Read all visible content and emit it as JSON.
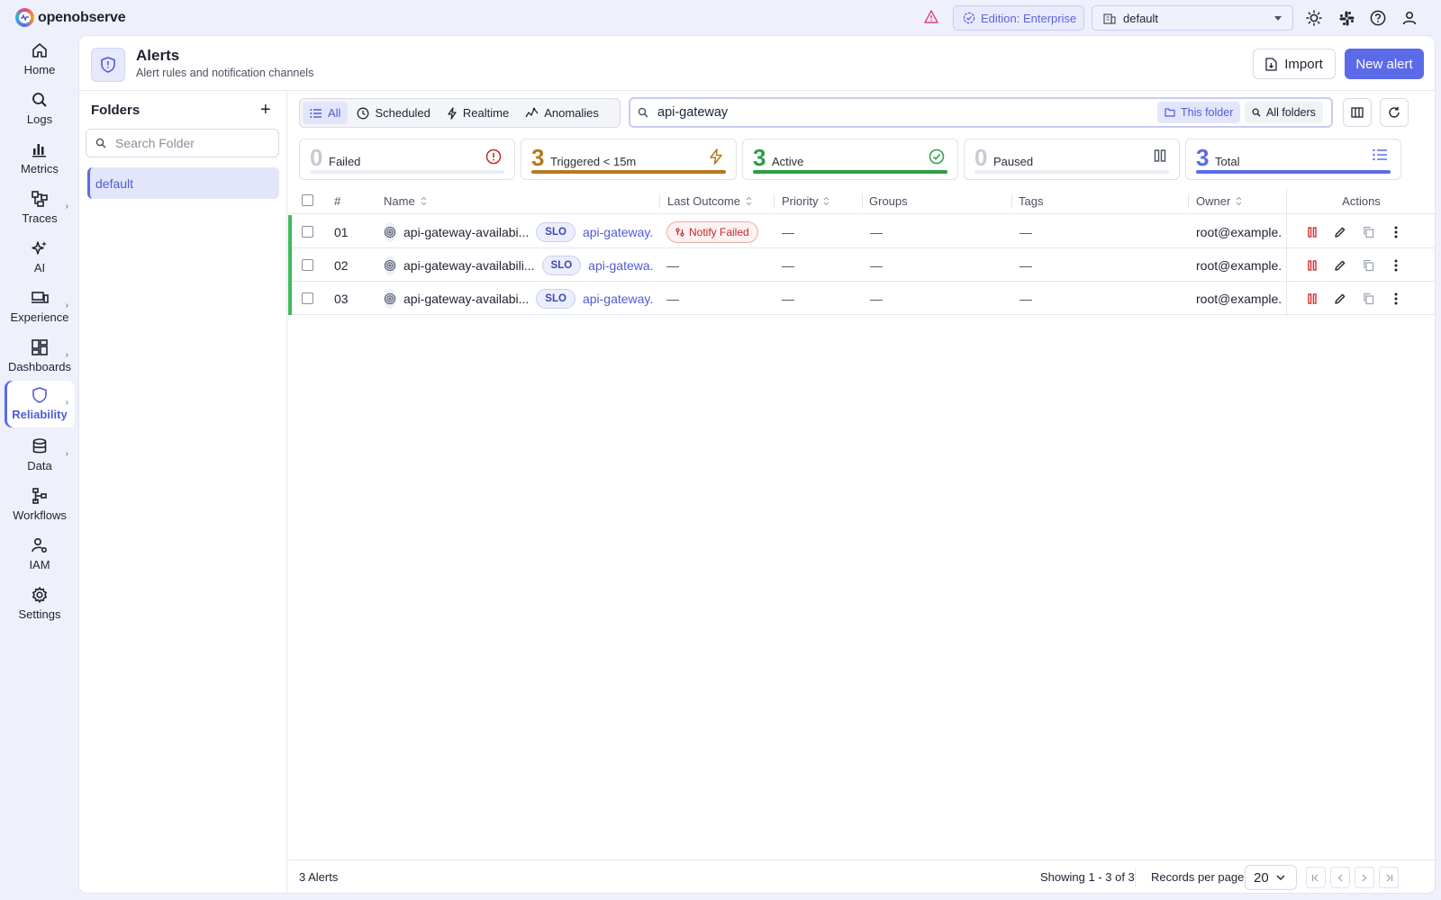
{
  "app": {
    "name": "openobserve"
  },
  "topbar": {
    "edition": "Edition: Enterprise",
    "org": "default"
  },
  "nav": [
    {
      "label": "Home",
      "icon": "home-icon"
    },
    {
      "label": "Logs",
      "icon": "search-icon"
    },
    {
      "label": "Metrics",
      "icon": "bar-chart-icon"
    },
    {
      "label": "Traces",
      "icon": "traces-icon"
    },
    {
      "label": "AI",
      "icon": "sparkle-icon"
    },
    {
      "label": "Experience",
      "icon": "devices-icon"
    },
    {
      "label": "Dashboards",
      "icon": "dashboard-icon"
    },
    {
      "label": "Reliability",
      "icon": "shield-icon"
    },
    {
      "label": "Data",
      "icon": "database-icon"
    },
    {
      "label": "Workflows",
      "icon": "workflow-icon"
    },
    {
      "label": "IAM",
      "icon": "user-gear-icon"
    },
    {
      "label": "Settings",
      "icon": "gear-icon"
    }
  ],
  "header": {
    "title": "Alerts",
    "subtitle": "Alert rules and notification channels",
    "import_label": "Import",
    "new_label": "New alert"
  },
  "folders": {
    "title": "Folders",
    "search_placeholder": "Search Folder",
    "items": [
      "default"
    ]
  },
  "filters": {
    "tabs": [
      "All",
      "Scheduled",
      "Realtime",
      "Anomalies"
    ],
    "active": "All",
    "search_value": "api-gateway",
    "scope_this": "This folder",
    "scope_all": "All folders"
  },
  "stats": [
    {
      "value": "0",
      "label": "Failed",
      "color": "#c62828",
      "fill": 0
    },
    {
      "value": "3",
      "label": "Triggered < 15m",
      "color": "#b7791f",
      "fill": 1
    },
    {
      "value": "3",
      "label": "Active",
      "color": "#2e9e48",
      "fill": 1
    },
    {
      "value": "0",
      "label": "Paused",
      "color": "#6b7080",
      "fill": 0
    },
    {
      "value": "3",
      "label": "Total",
      "color": "#5b6be8",
      "fill": 1
    }
  ],
  "table": {
    "columns": [
      "#",
      "Name",
      "Last Outcome",
      "Priority",
      "Groups",
      "Tags",
      "Owner",
      "Actions"
    ],
    "rows": [
      {
        "num": "01",
        "name": "api-gateway-availabi...",
        "badge": "SLO",
        "link": "api-gateway...",
        "outcome": "Notify Failed",
        "priority": "—",
        "groups": "—",
        "tags": "—",
        "owner": "root@example."
      },
      {
        "num": "02",
        "name": "api-gateway-availabili...",
        "badge": "SLO",
        "link": "api-gatewa...",
        "outcome": "—",
        "priority": "—",
        "groups": "—",
        "tags": "—",
        "owner": "root@example."
      },
      {
        "num": "03",
        "name": "api-gateway-availabi...",
        "badge": "SLO",
        "link": "api-gateway...",
        "outcome": "—",
        "priority": "—",
        "groups": "—",
        "tags": "—",
        "owner": "root@example."
      }
    ]
  },
  "footer": {
    "count": "3 Alerts",
    "showing": "Showing 1 - 3 of 3",
    "rpp_label": "Records per page",
    "rpp_value": "20"
  }
}
